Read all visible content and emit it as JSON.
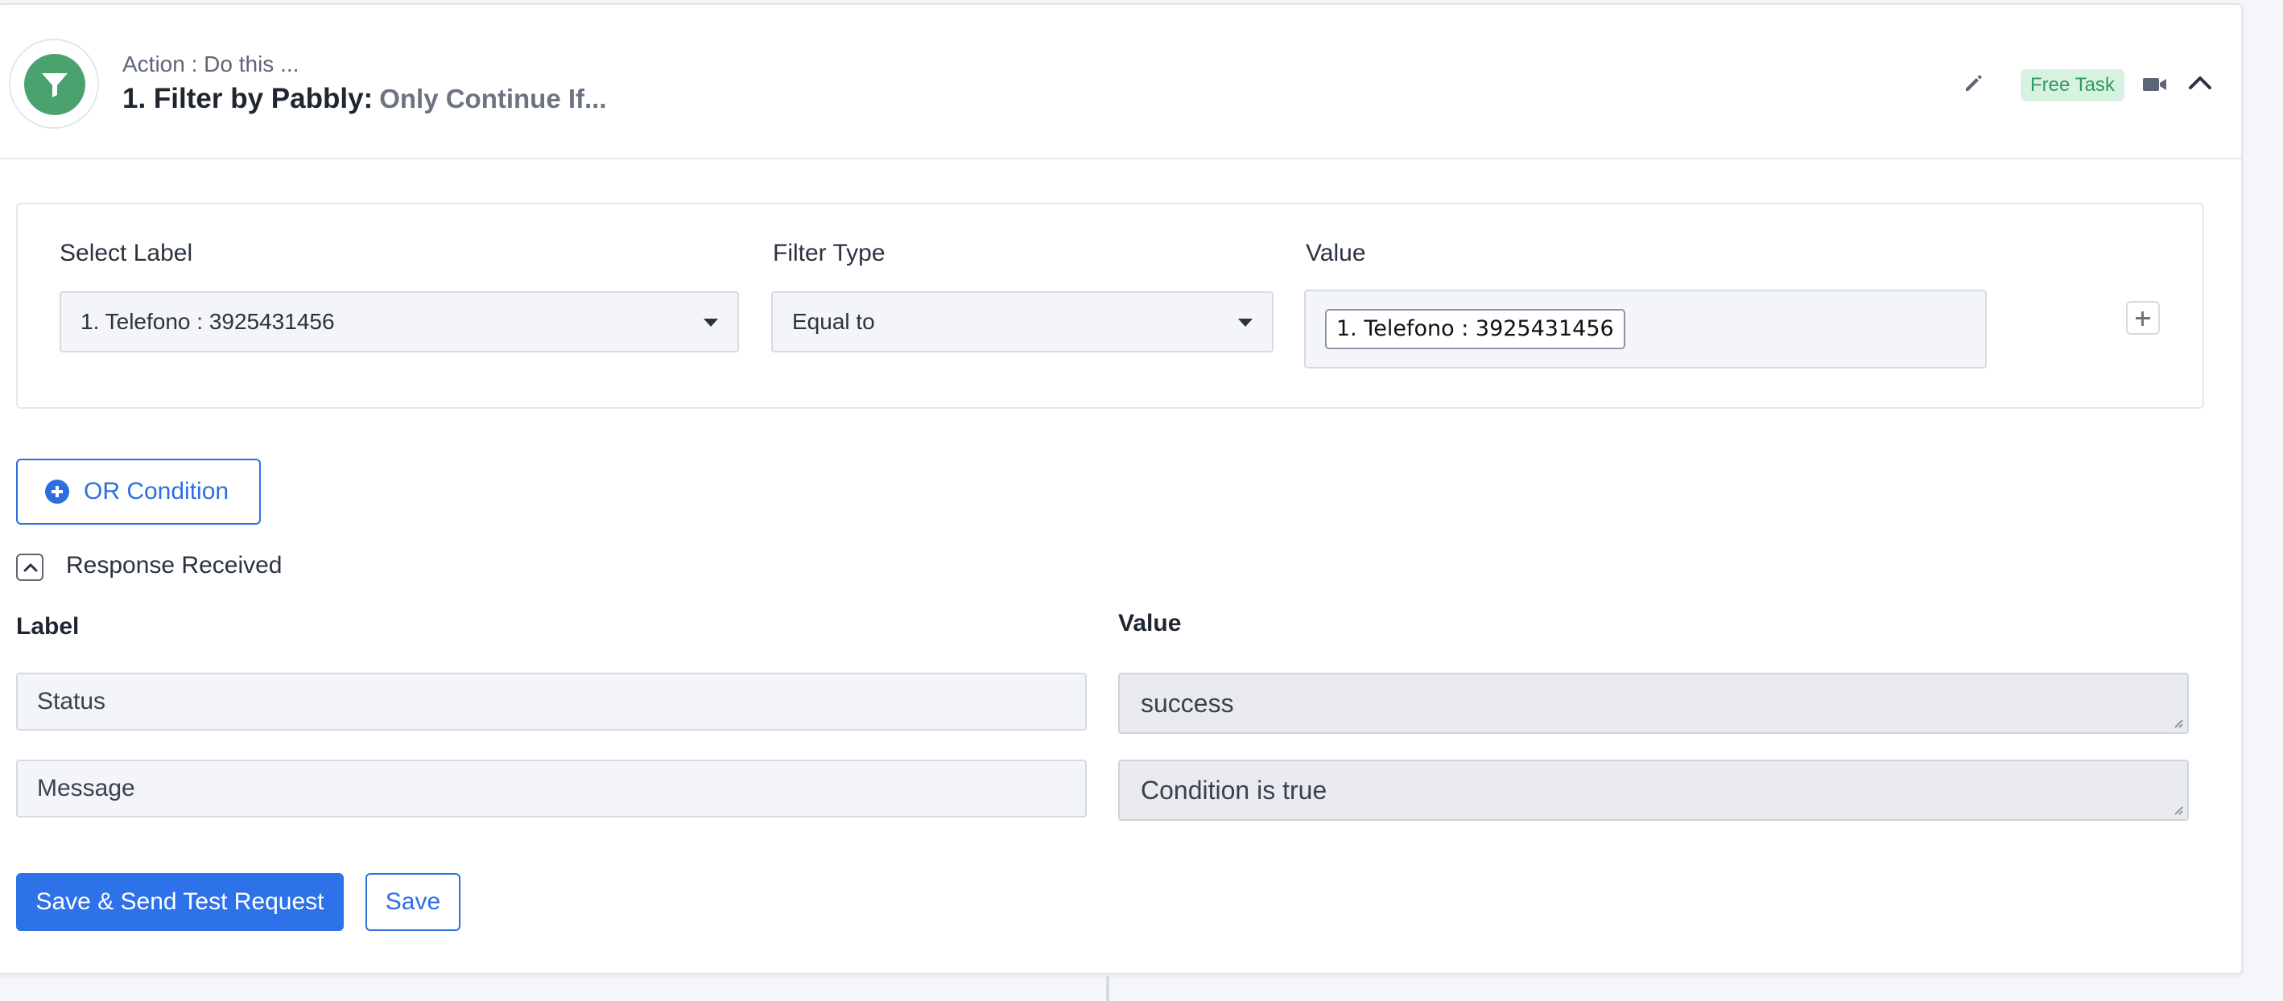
{
  "header": {
    "kicker": "Action : Do this ...",
    "app_name": "1. Filter by Pabbly:",
    "event_name": "Only Continue If...",
    "app_icon": "filter-icon",
    "badge": "Free Task",
    "tool_icons": [
      "pencil-icon",
      "video-camera-icon",
      "chevron-up-icon"
    ]
  },
  "filter": {
    "select_label": {
      "label": "Select Label",
      "value": "1. Telefono : 3925431456"
    },
    "filter_type": {
      "label": "Filter Type",
      "value": "Equal to"
    },
    "value": {
      "label": "Value",
      "token": "1. Telefono : 3925431456"
    },
    "add_icon": "plus-icon"
  },
  "or_condition": {
    "label": "OR Condition",
    "icon": "plus-circle-icon"
  },
  "response": {
    "title": "Response Received",
    "toggle_icon": "chevron-up-icon",
    "label_header": "Label",
    "value_header": "Value",
    "rows": [
      {
        "label": "Status",
        "value": "success"
      },
      {
        "label": "Message",
        "value": "Condition is true"
      }
    ]
  },
  "actions": {
    "save_and_test": "Save & Send Test Request",
    "save": "Save"
  },
  "colors": {
    "accent": "#2d72e8",
    "app_icon_bg": "#4aa36f",
    "badge_bg": "#d8f2e2",
    "badge_text": "#2f9b5c"
  }
}
